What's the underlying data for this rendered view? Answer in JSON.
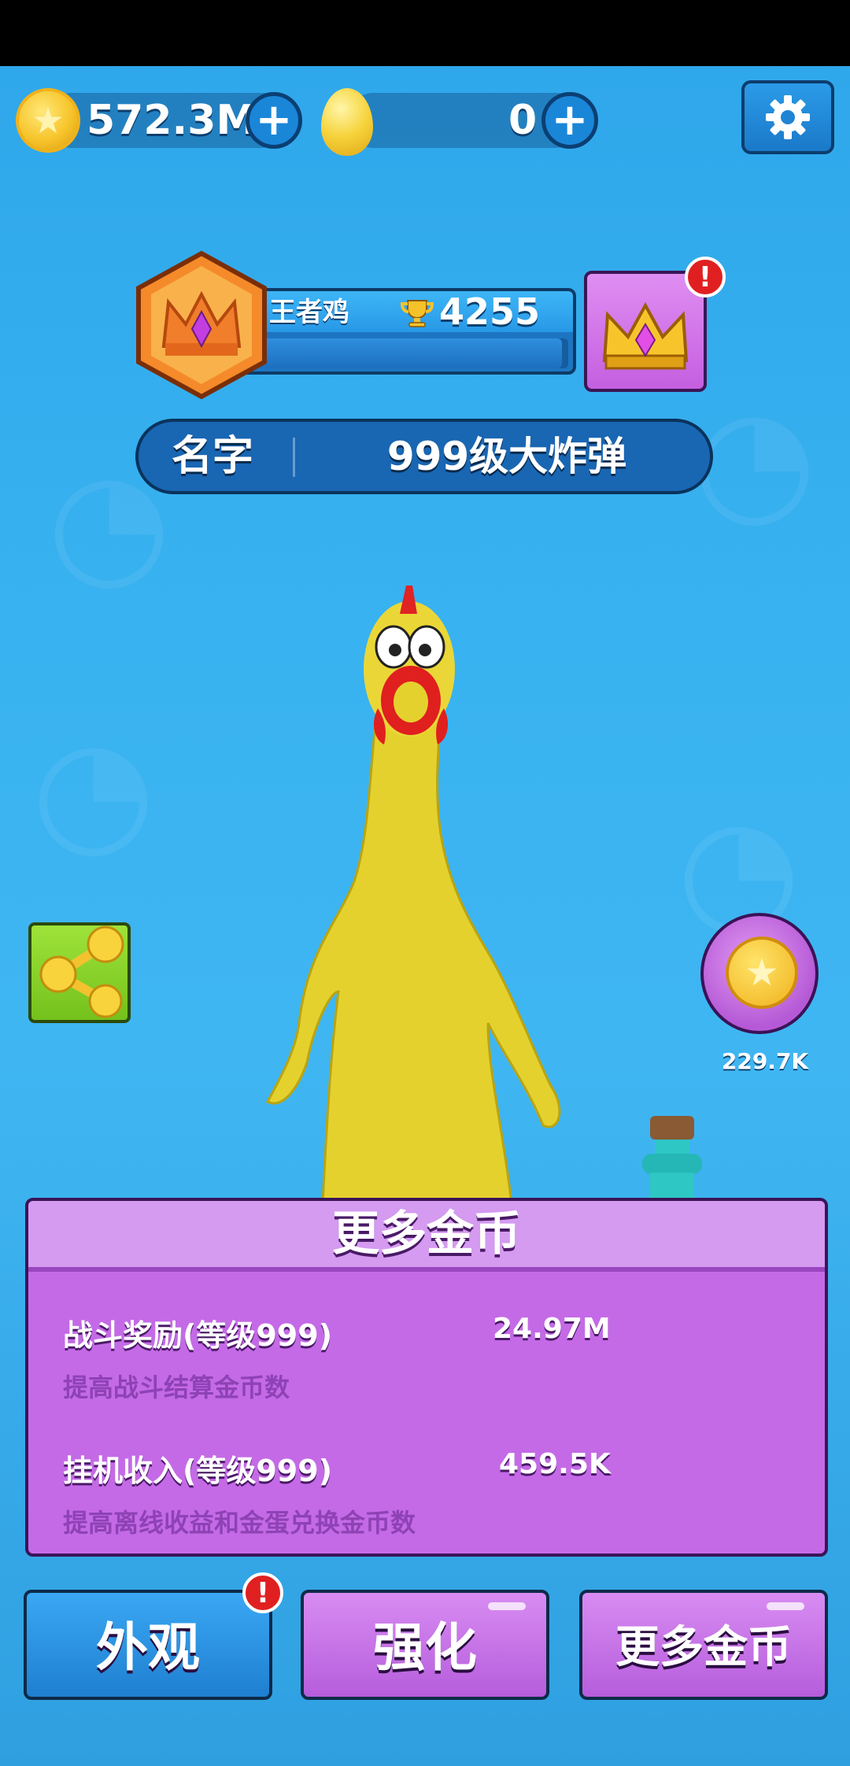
{
  "currency": {
    "coins": "572.3M",
    "eggs": "0",
    "coin_icon": "star-coin-icon",
    "egg_icon": "golden-egg-icon",
    "plus_icon": "plus-icon"
  },
  "settings": {
    "icon": "gear-icon"
  },
  "rank": {
    "title": "王者鸡",
    "trophies": "4255",
    "progress": 0.98
  },
  "profile": {
    "name_label": "名字",
    "name_value": "999级大炸弹"
  },
  "coin_bonus": {
    "value": "229.7K"
  },
  "panel": {
    "title": "更多金币",
    "upgrades": [
      {
        "name": "战斗奖励(等级999)",
        "value": "24.97M",
        "desc": "提高战斗结算金币数"
      },
      {
        "name": "挂机收入(等级999)",
        "value": "459.5K",
        "desc": "提高离线收益和金蛋兑换金币数"
      }
    ]
  },
  "tabs": [
    {
      "label": "外观",
      "alert": "!"
    },
    {
      "label": "强化"
    },
    {
      "label": "更多金币"
    }
  ],
  "alerts": {
    "crown": "!"
  },
  "colors": {
    "background": "#38b2f0",
    "panel": "#c46ae6",
    "tab_blue": "#1f7fd0",
    "tab_purple": "#b65ddc",
    "alert": "#e02020"
  }
}
